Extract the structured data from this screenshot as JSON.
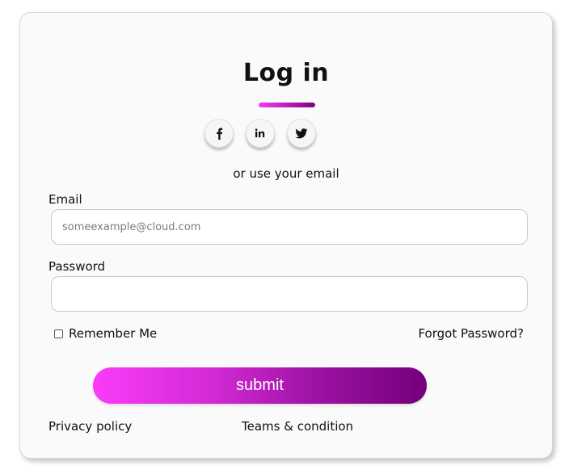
{
  "login": {
    "title": "Log in",
    "social": [
      {
        "name": "facebook-icon"
      },
      {
        "name": "linkedin-icon"
      },
      {
        "name": "twitter-icon"
      }
    ],
    "alt_text": "or use your email",
    "email": {
      "label": "Email",
      "placeholder": "someexample@cloud.com",
      "value": ""
    },
    "password": {
      "label": "Password",
      "value": ""
    },
    "remember_label": "Remember Me",
    "remember_checked": false,
    "forgot_label": "Forgot Password?",
    "submit_label": "submit",
    "footer": {
      "privacy": "Privacy policy",
      "terms": "Teams & condition"
    },
    "colors": {
      "accent_start": "#f93cf9",
      "accent_end": "#74007a"
    }
  }
}
